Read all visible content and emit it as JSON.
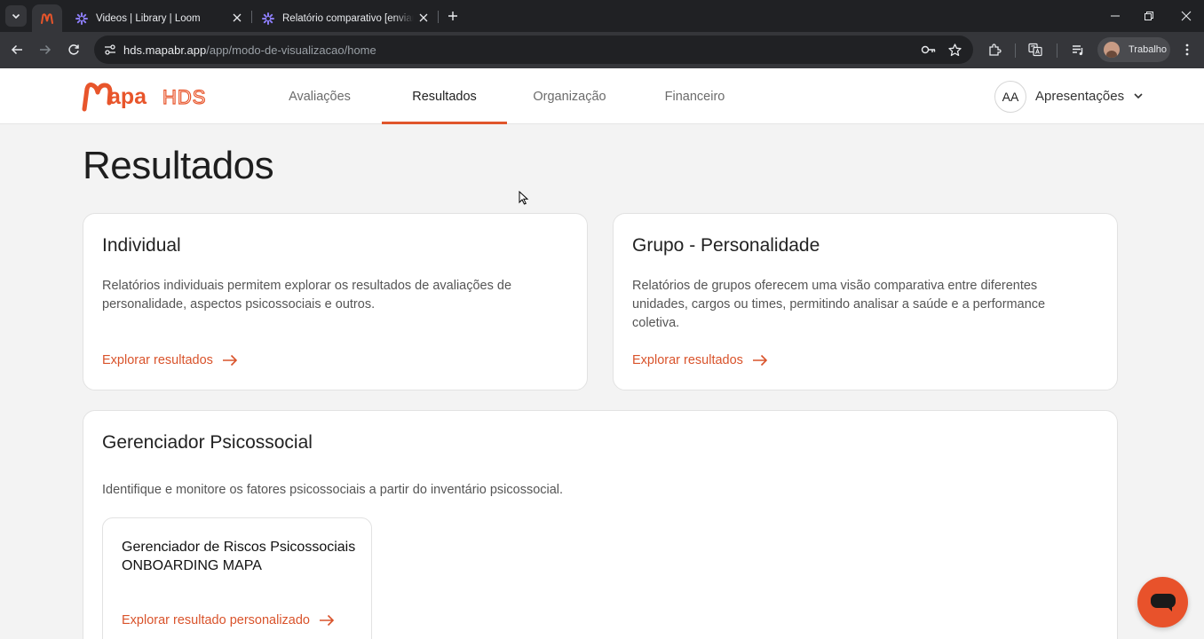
{
  "browser": {
    "tabs": [
      {
        "title": "",
        "favicon": "mapa-logo-icon",
        "active": true
      },
      {
        "title": "Videos | Library | Loom",
        "favicon": "loom-icon",
        "active": false
      },
      {
        "title": "Relatório comparativo [enviar p",
        "favicon": "loom-icon",
        "active": false
      }
    ],
    "url_host": "hds.mapabr.app",
    "url_path": "/app/modo-de-visualizacao/home",
    "profile_label": "Trabalho"
  },
  "app": {
    "logo_text": "MapaHDS",
    "nav": [
      {
        "label": "Avaliações",
        "active": false
      },
      {
        "label": "Resultados",
        "active": true
      },
      {
        "label": "Organização",
        "active": false
      },
      {
        "label": "Financeiro",
        "active": false
      }
    ],
    "user_initials": "AA",
    "workspace_label": "Apresentações",
    "accent_color": "#e0552b"
  },
  "page": {
    "title": "Resultados",
    "cards": [
      {
        "title": "Individual",
        "description": "Relatórios individuais permitem explorar os resultados de avaliações de personalidade, aspectos psicossociais e outros.",
        "link": "Explorar resultados"
      },
      {
        "title": "Grupo - Personalidade",
        "description": "Relatórios de grupos oferecem uma visão comparativa entre diferentes unidades, cargos ou times, permitindo analisar a saúde e a performance coletiva.",
        "link": "Explorar resultados"
      }
    ],
    "manager": {
      "title": "Gerenciador Psicossocial",
      "description": "Identifique e monitore os fatores psicossociais a partir do inventário psicossocial.",
      "item": {
        "title": "Gerenciador de Riscos Psicossociais ONBOARDING MAPA",
        "link": "Explorar resultado personalizado"
      }
    }
  }
}
